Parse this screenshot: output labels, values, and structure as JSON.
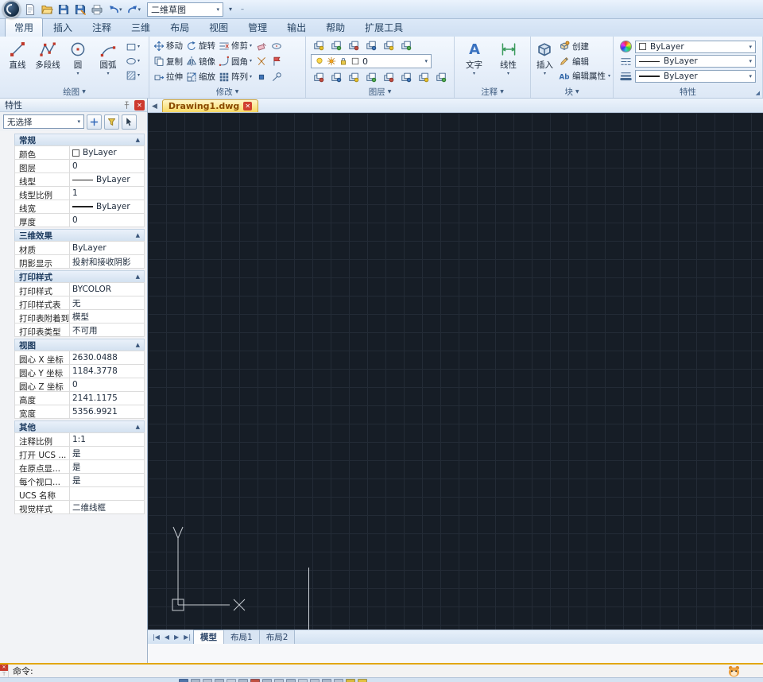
{
  "colors": {
    "canvas_bg": "#161d26",
    "grid_line": "#232b36",
    "doc_tab_yellow": "#f7d964",
    "command_divider": "#e2a70c",
    "ribbon_bg": "#e3eefb"
  },
  "qat": {
    "workspace_value": "二维草图"
  },
  "ribbon_tabs": [
    {
      "label": "常用",
      "active": true
    },
    {
      "label": "插入"
    },
    {
      "label": "注释"
    },
    {
      "label": "三维"
    },
    {
      "label": "布局"
    },
    {
      "label": "视图"
    },
    {
      "label": "管理"
    },
    {
      "label": "输出"
    },
    {
      "label": "帮助"
    },
    {
      "label": "扩展工具"
    }
  ],
  "ribbon": {
    "draw": {
      "title": "绘图",
      "buttons": [
        {
          "label": "直线",
          "icon": "line",
          "dropdown": false
        },
        {
          "label": "多段线",
          "icon": "polyline",
          "dropdown": false
        },
        {
          "label": "圆",
          "icon": "circle",
          "dropdown": true
        },
        {
          "label": "圆弧",
          "icon": "arc",
          "dropdown": true
        }
      ],
      "side_icons": [
        "rect",
        "ellipse",
        "hatch"
      ]
    },
    "modify": {
      "title": "修改",
      "rows": [
        [
          {
            "label": "移动",
            "icon": "move"
          },
          {
            "label": "旋转",
            "icon": "rotate"
          },
          {
            "label": "修剪",
            "icon": "trim",
            "dropdown": true
          }
        ],
        [
          {
            "label": "复制",
            "icon": "copy"
          },
          {
            "label": "镜像",
            "icon": "mirror"
          },
          {
            "label": "圆角",
            "icon": "fillet",
            "dropdown": true
          }
        ],
        [
          {
            "label": "拉伸",
            "icon": "stretch"
          },
          {
            "label": "缩放",
            "icon": "scale"
          },
          {
            "label": "阵列",
            "icon": "array",
            "dropdown": true
          }
        ]
      ],
      "extra_icons": [
        [
          "erase",
          "oval"
        ],
        [
          "explode",
          "flag"
        ],
        [
          "grip",
          "misc"
        ]
      ]
    },
    "layers": {
      "title": "图层",
      "current_layer": "0",
      "row1_count": 6,
      "row3_count": 8
    },
    "annotate": {
      "title": "注释",
      "buttons": [
        {
          "label": "文字",
          "icon": "text"
        },
        {
          "label": "线性",
          "icon": "dim"
        }
      ]
    },
    "block": {
      "title": "块",
      "big": {
        "label": "插入",
        "icon": "insert"
      },
      "small": [
        {
          "label": "创建",
          "icon": "createblk"
        },
        {
          "label": "编辑",
          "icon": "editblk"
        },
        {
          "label": "编辑属性",
          "icon": "attrblk",
          "dropdown": true
        }
      ]
    },
    "properties": {
      "title": "特性",
      "combos": [
        {
          "kind": "color",
          "value": "ByLayer"
        },
        {
          "kind": "linetype",
          "value": "ByLayer"
        },
        {
          "kind": "lineweight",
          "value": "ByLayer"
        }
      ]
    }
  },
  "doc_tab": {
    "name": "Drawing1.dwg"
  },
  "palette": {
    "title": "特性",
    "selection_value": "无选择",
    "sections": [
      {
        "header": "常规",
        "rows": [
          {
            "label": "颜色",
            "value": "ByLayer",
            "swatch": true
          },
          {
            "label": "图层",
            "value": "0"
          },
          {
            "label": "线型",
            "value": "ByLayer",
            "linetype": true
          },
          {
            "label": "线型比例",
            "value": "1"
          },
          {
            "label": "线宽",
            "value": "ByLayer",
            "lineweight": true
          },
          {
            "label": "厚度",
            "value": "0"
          }
        ]
      },
      {
        "header": "三维效果",
        "rows": [
          {
            "label": "材质",
            "value": "ByLayer"
          },
          {
            "label": "阴影显示",
            "value": "投射和接收阴影"
          }
        ]
      },
      {
        "header": "打印样式",
        "rows": [
          {
            "label": "打印样式",
            "value": "BYCOLOR"
          },
          {
            "label": "打印样式表",
            "value": "无"
          },
          {
            "label": "打印表附着到",
            "value": "模型"
          },
          {
            "label": "打印表类型",
            "value": "不可用"
          }
        ]
      },
      {
        "header": "视图",
        "rows": [
          {
            "label": "圆心 X 坐标",
            "value": "2630.0488"
          },
          {
            "label": "圆心 Y 坐标",
            "value": "1184.3778"
          },
          {
            "label": "圆心 Z 坐标",
            "value": "0"
          },
          {
            "label": "高度",
            "value": "2141.1175"
          },
          {
            "label": "宽度",
            "value": "5356.9921"
          }
        ]
      },
      {
        "header": "其他",
        "rows": [
          {
            "label": "注释比例",
            "value": "1:1"
          },
          {
            "label": "打开 UCS ...",
            "value": "是"
          },
          {
            "label": "在原点显...",
            "value": "是"
          },
          {
            "label": "每个视口...",
            "value": "是"
          },
          {
            "label": "UCS 名称",
            "value": ""
          },
          {
            "label": "视觉样式",
            "value": "二维线框"
          }
        ]
      }
    ]
  },
  "layout_bar": {
    "tabs": [
      {
        "label": "模型",
        "active": true
      },
      {
        "label": "布局1"
      },
      {
        "label": "布局2"
      }
    ]
  },
  "command": {
    "prompt": "命令:"
  }
}
